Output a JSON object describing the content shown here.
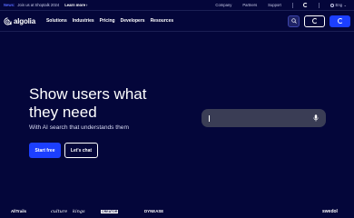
{
  "topbar": {
    "news_label": "News:",
    "message": "Join us at Shoptalk 2024",
    "learn_more": "Learn more",
    "learn_arrow": "›",
    "links": [
      "Company",
      "Partners",
      "Support"
    ],
    "lang": "Eng",
    "lang_chevron": "⌄"
  },
  "nav": {
    "logo_text": "algolia",
    "links": [
      {
        "label": "Solutions"
      },
      {
        "label": "Industries"
      },
      {
        "label": "Pricing"
      },
      {
        "label": "Developers"
      },
      {
        "label": "Resources"
      }
    ]
  },
  "hero": {
    "title": "Show users what they need",
    "subtitle": "With AI search that understands them",
    "start_button": "Start free",
    "chat_button": "Let's chat"
  },
  "customer_logos": [
    "AllTrails",
    "culture",
    "kings",
    "CREATOR",
    "DYNEASE",
    "swedol"
  ],
  "colors": {
    "background": "#04063a",
    "accent": "#1c3fff",
    "search_bg": "#3a3d55"
  },
  "icons": {
    "search": "search-icon",
    "mic": "microphone-icon",
    "globe": "globe-icon"
  }
}
